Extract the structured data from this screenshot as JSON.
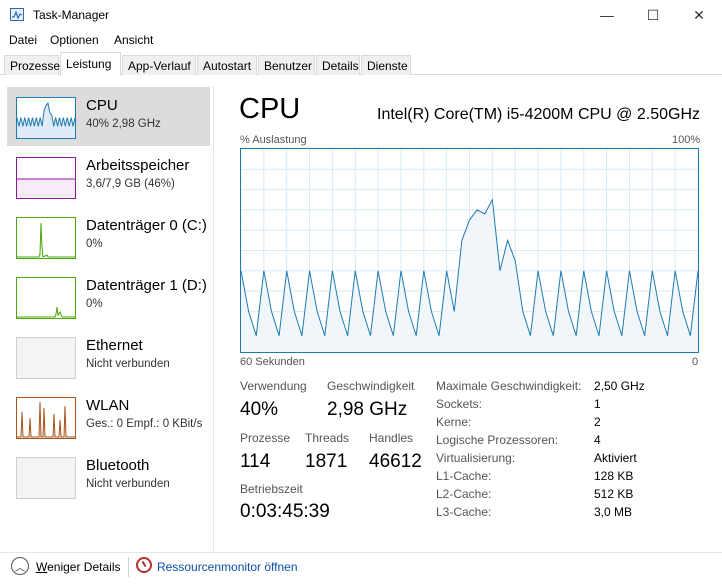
{
  "window": {
    "title": "Task-Manager",
    "minimize_glyph": "—",
    "maximize_glyph": "☐",
    "close_glyph": "✕"
  },
  "menu": [
    "Datei",
    "Optionen",
    "Ansicht"
  ],
  "tabs": [
    "Prozesse",
    "Leistung",
    "App-Verlauf",
    "Autostart",
    "Benutzer",
    "Details",
    "Dienste"
  ],
  "active_tab": "Leistung",
  "sidebar": {
    "items": [
      {
        "name": "CPU",
        "sub": "40% 2,98 GHz",
        "icon": "cpu-graph-icon",
        "color": "#1f7ab3",
        "selected": true
      },
      {
        "name": "Arbeitsspeicher",
        "sub": "3,6/7,9 GB (46%)",
        "icon": "memory-graph-icon",
        "color": "#8b1a9b"
      },
      {
        "name": "Datenträger 0 (C:)",
        "sub": "0%",
        "icon": "disk-graph-icon",
        "color": "#4da60c"
      },
      {
        "name": "Datenträger 1 (D:)",
        "sub": "0%",
        "icon": "disk-graph-icon",
        "color": "#4da60c"
      },
      {
        "name": "Ethernet",
        "sub": "Nicht verbunden",
        "icon": "ethernet-graph-icon",
        "color": "#cfcfcf"
      },
      {
        "name": "WLAN",
        "sub": "Ges.: 0 Empf.: 0 KBit/s",
        "icon": "wlan-graph-icon",
        "color": "#a7531a"
      },
      {
        "name": "Bluetooth",
        "sub": "Nicht verbunden",
        "icon": "bluetooth-graph-icon",
        "color": "#cfcfcf"
      }
    ]
  },
  "main": {
    "title": "CPU",
    "model": "Intel(R) Core(TM) i5-4200M CPU @ 2.50GHz",
    "graph": {
      "top_left_label": "% Auslastung",
      "top_right_label": "100%",
      "bottom_left_label": "60 Sekunden",
      "bottom_right_label": "0",
      "line_color": "#1f7ab3",
      "fill_color": "#f1f6fb",
      "grid_color": "#d9eaf5"
    },
    "stats": {
      "usage_label": "Verwendung",
      "usage_value": "40%",
      "speed_label": "Geschwindigkeit",
      "speed_value": "2,98 GHz",
      "processes_label": "Prozesse",
      "processes_value": "114",
      "threads_label": "Threads",
      "threads_value": "1871",
      "handles_label": "Handles",
      "handles_value": "46612",
      "uptime_label": "Betriebszeit",
      "uptime_value": "0:03:45:39"
    },
    "details": [
      {
        "label": "Maximale Geschwindigkeit:",
        "value": "2,50 GHz"
      },
      {
        "label": "Sockets:",
        "value": "1"
      },
      {
        "label": "Kerne:",
        "value": "2"
      },
      {
        "label": "Logische Prozessoren:",
        "value": "4"
      },
      {
        "label": "Virtualisierung:",
        "value": "Aktiviert"
      },
      {
        "label": "L1-Cache:",
        "value": "128 KB"
      },
      {
        "label": "L2-Cache:",
        "value": "512 KB"
      },
      {
        "label": "L3-Cache:",
        "value": "3,0 MB"
      }
    ]
  },
  "footer": {
    "fewer_details": "Weniger Details",
    "fewer_details_underlined_char": "W",
    "resource_monitor": "Ressourcenmonitor öffnen"
  }
}
